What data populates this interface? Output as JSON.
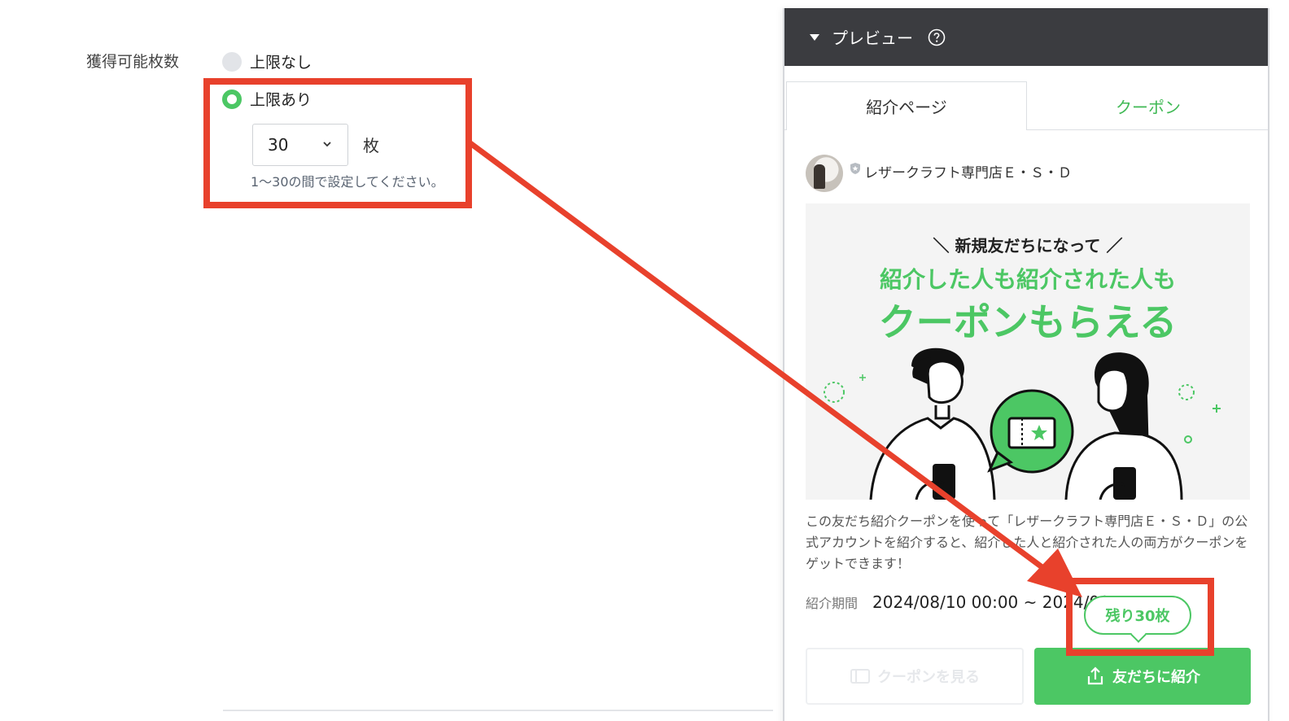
{
  "form": {
    "field_label": "獲得可能枚数",
    "options": [
      {
        "label": "上限なし",
        "selected": false
      },
      {
        "label": "上限あり",
        "selected": true
      }
    ],
    "count_select_value": "30",
    "unit": "枚",
    "hint": "1〜30の間で設定してください。"
  },
  "preview": {
    "title": "プレビュー",
    "tabs": [
      {
        "label": "紹介ページ",
        "active": true
      },
      {
        "label": "クーポン",
        "active": false
      }
    ],
    "account_name": "レザークラフト専門店Ｅ・Ｓ・Ｄ",
    "hero": {
      "subline": "＼ 新規友だちになって ／",
      "line1": "紹介した人も紹介された人も",
      "line2": "クーポンもらえる"
    },
    "description": "この友だち紹介クーポンを使って「レザークラフト専門店Ｅ・Ｓ・Ｄ」の公式アカウントを紹介すると、紹介した人と紹介された人の両方がクーポンをゲットできます！",
    "period_label": "紹介期間",
    "period_value": "2024/08/10 00:00 ~ 2024/09",
    "remaining_badge": "残り30枚",
    "view_coupon_button": "クーポンを見る",
    "share_button": "友だちに紹介"
  },
  "colors": {
    "accent_green": "#4cc764",
    "annotation_red": "#e8412c",
    "header_dark": "#3b3c40"
  }
}
